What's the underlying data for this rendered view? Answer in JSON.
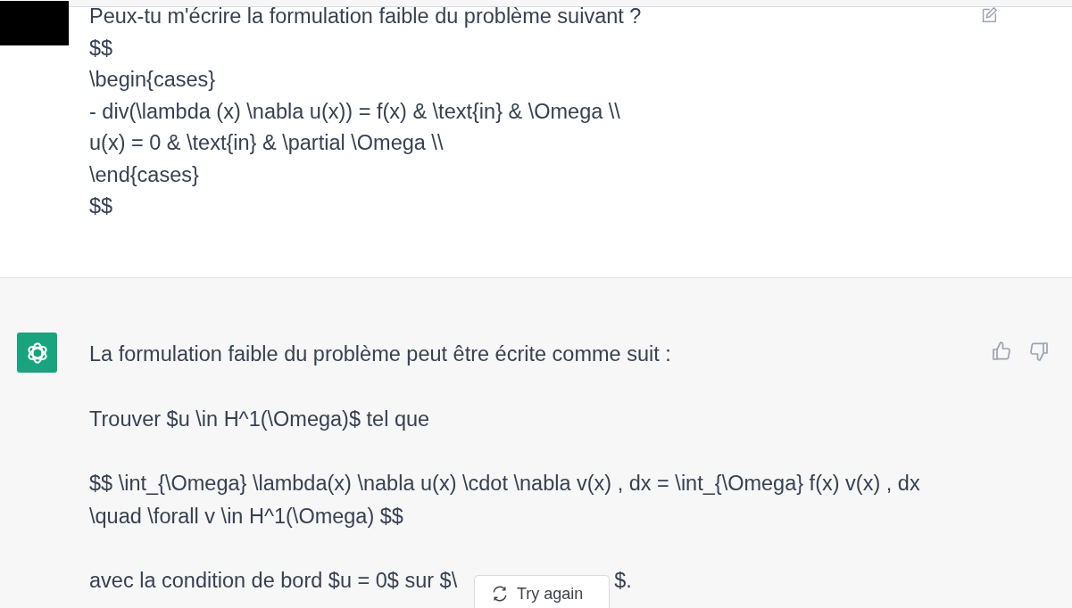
{
  "user_message": {
    "lines": [
      "Peux-tu m'écrire la formulation faible du problème suivant ?",
      "$$",
      "\\begin{cases}",
      "- div(\\lambda (x) \\nabla u(x)) = f(x) & \\text{in} & \\Omega \\\\",
      "u(x) = 0 & \\text{in} & \\partial \\Omega \\\\",
      "\\end{cases}",
      "$$"
    ]
  },
  "assistant_message": {
    "paragraphs": [
      "La formulation faible du problème peut être écrite comme suit :",
      "Trouver $u \\in H^1(\\Omega)$ tel que",
      "$$ \\int_{\\Omega} \\lambda(x) \\nabla u(x) \\cdot \\nabla v(x) , dx = \\int_{\\Omega} f(x) v(x) , dx \\quad \\forall v \\in H^1(\\Omega) $$"
    ],
    "last_line": {
      "before": "avec la condition de bord $u = 0$ sur $\\",
      "after": "$."
    }
  },
  "try_again_button": {
    "label": "Try again"
  }
}
